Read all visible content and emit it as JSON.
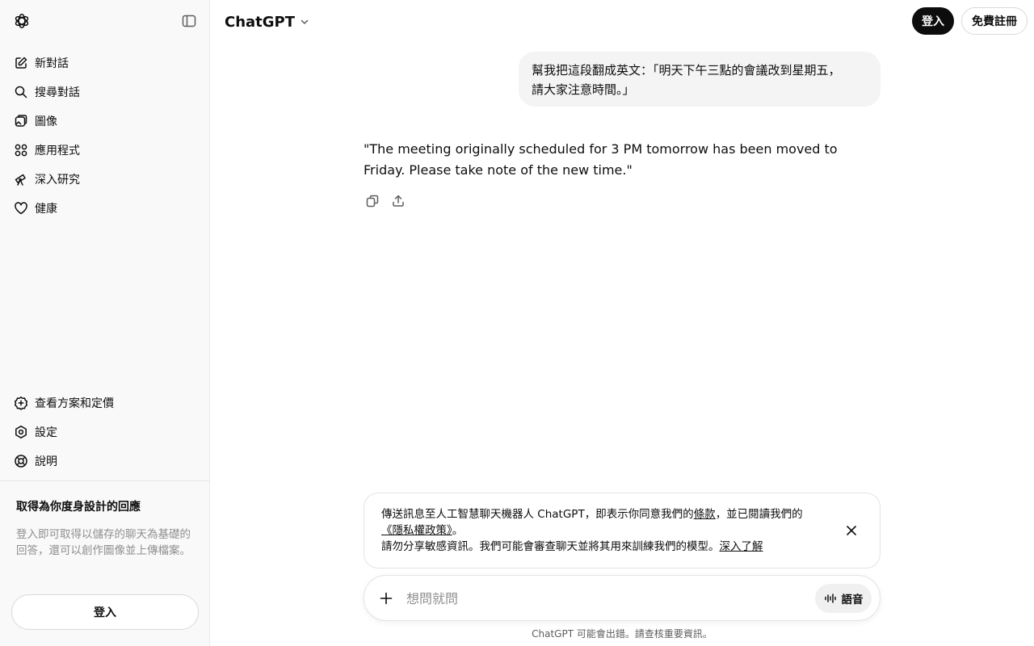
{
  "app": {
    "model_name": "ChatGPT"
  },
  "header": {
    "login_label": "登入",
    "signup_label": "免費註冊"
  },
  "sidebar": {
    "items": [
      {
        "label": "新對話",
        "icon": "new-chat-icon"
      },
      {
        "label": "搜尋對話",
        "icon": "search-icon"
      },
      {
        "label": "圖像",
        "icon": "images-icon"
      },
      {
        "label": "應用程式",
        "icon": "apps-icon"
      },
      {
        "label": "深入研究",
        "icon": "telescope-icon"
      },
      {
        "label": "健康",
        "icon": "heart-icon"
      }
    ],
    "bottom_items": [
      {
        "label": "查看方案和定價",
        "icon": "upgrade-icon"
      },
      {
        "label": "設定",
        "icon": "gear-icon"
      },
      {
        "label": "說明",
        "icon": "help-icon"
      }
    ],
    "promo": {
      "title": "取得為你度身設計的回應",
      "description": "登入即可取得以儲存的聊天為基礎的回答，還可以創作圖像並上傳檔案。"
    },
    "login_label": "登入"
  },
  "conversation": {
    "user_message_line1": "幫我把這段翻成英文：「明天下午三點的會議改到星期五，",
    "user_message_line2": "請大家注意時間。」",
    "assistant_message": "\"The meeting originally scheduled for 3 PM tomorrow has been moved to Friday. Please take note of the new time.\""
  },
  "notice": {
    "text1": "傳送訊息至人工智慧聊天機器人 ChatGPT，即表示你同意我們的",
    "terms_link": "條款",
    "text2": "，並已閱讀我們的",
    "privacy_link": "《隱私權政策》",
    "text3": "。",
    "text4": "請勿分享敏感資訊。我們可能會審查聊天並將其用來訓練我們的模型。",
    "learn_more_link": "深入了解"
  },
  "composer": {
    "placeholder": "想問就問",
    "voice_label": "語音"
  },
  "disclaimer": "ChatGPT 可能會出錯。請查核重要資訊。"
}
